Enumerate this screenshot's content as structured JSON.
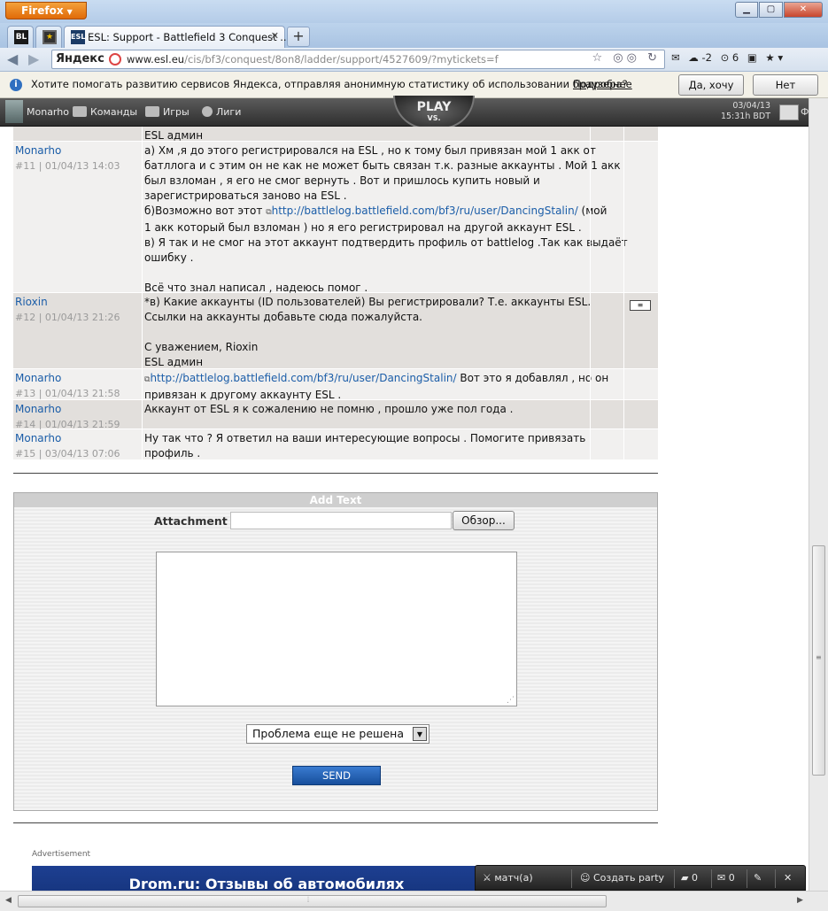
{
  "browser": {
    "menu_label": "Firefox",
    "window_buttons": {
      "minimize": "▁",
      "maximize": "▢",
      "close": "✕"
    },
    "tabs": [
      {
        "label": "",
        "favicon": "BL"
      },
      {
        "label": "",
        "favicon": "★"
      },
      {
        "label": "ESL: Support - Battlefield 3 Conquest ...",
        "favicon": "ESL",
        "active": true
      }
    ],
    "new_tab": "+",
    "search_brand": "Яндекс",
    "url_host": "www.esl.eu",
    "url_path": "/cis/bf3/conquest/8on8/ladder/support/4527609/?mytickets=f",
    "url_icons": "☆ ◎◎ ↻",
    "toolbar_items": [
      "✉",
      "☁ -2",
      "⊙ 6",
      "▣",
      "★ ▾"
    ]
  },
  "infobar": {
    "text": "Хотите помогать развитию сервисов Яндекса, отправляя анонимную статистику об использовании браузера?",
    "link": "Подробнее",
    "yes_button": "Да, хочу",
    "no_button": "Нет"
  },
  "site_nav": {
    "user": "Monarho",
    "items": [
      "Команды",
      "Игры",
      "Лиги"
    ],
    "logo_main": "PLAY",
    "logo_sub": "VS.",
    "date": "03/04/13",
    "time": "15:31h BDT",
    "right_label": "Ф"
  },
  "messages": [
    {
      "author": "",
      "meta": "",
      "lines": [
        "ESL админ"
      ],
      "style": "alt",
      "has_mail": false
    },
    {
      "author": "Monarho",
      "meta": "#11 | 01/04/13 14:03",
      "lines": [
        "а) Хм ,я до этого регистрировался на ESL , но к тому был привязан мой 1 акк от",
        "батллога и с этим он не как не может быть связан т.к. разные аккаунты . Мой 1 акк",
        "был взломан , я его не смог вернуть . Вот и пришлось купить новый и",
        "зарегистрироваться заново на ESL .",
        "б)Возможно вот этот ",
        "1 акк который был взломан ) но я его регистрировал на другой аккаунт ESL .",
        "в) Я так и не смог на этот аккаунт подтвердить профиль от battlelog .Так как выдаёт",
        "ошибку .",
        " ",
        "Всё что знал написал , надеюсь помог ."
      ],
      "link_line_index": 4,
      "link": "http://battlelog.battlefield.com/bf3/ru/user/DancingStalin/",
      "link_after": " (мой",
      "style": "norm",
      "has_mail": false
    },
    {
      "author": "Rioxin",
      "meta": "#12 | 01/04/13 21:26",
      "lines": [
        "*в) Какие аккаунты (ID пользователей) Вы регистрировали? Т.е. аккаунты ESL.",
        "Ссылки на аккаунты добавьте сюда пожалуйста.",
        " ",
        "С уважением, Rioxin",
        "ESL админ"
      ],
      "style": "alt",
      "has_mail": true
    },
    {
      "author": "Monarho",
      "meta": "#13 | 01/04/13 21:58",
      "lines": [
        "",
        "привязан к другому аккаунту ESL ."
      ],
      "link_line_index": 0,
      "link": "http://battlelog.battlefield.com/bf3/ru/user/DancingStalin/",
      "link_after": " Вот это я добавлял , но он",
      "style": "norm",
      "has_mail": false
    },
    {
      "author": "Monarho",
      "meta": "#14 | 01/04/13 21:59",
      "lines": [
        "Аккаунт от ESL я к сожалению не помню , прошло уже пол года ."
      ],
      "style": "alt",
      "has_mail": false
    },
    {
      "author": "Monarho",
      "meta": "#15 | 03/04/13 07:06",
      "lines": [
        "Ну так что ? Я ответил на ваши интересующие вопросы . Помогите привязать",
        "профиль ."
      ],
      "style": "norm",
      "has_mail": false
    }
  ],
  "add_text": {
    "title": "Add Text",
    "attachment_label": "Attachment",
    "browse_button": "Обзор...",
    "status_selected": "Проблема еще не решена",
    "send_button": "SEND"
  },
  "ad": {
    "label": "Advertisement",
    "banner_text": "Drom.ru: Отзывы об автомобилях"
  },
  "bottom_bar": {
    "matches": "матч(а)",
    "create_party": "Создать party",
    "chat_count": "0",
    "mail_count": "0"
  }
}
